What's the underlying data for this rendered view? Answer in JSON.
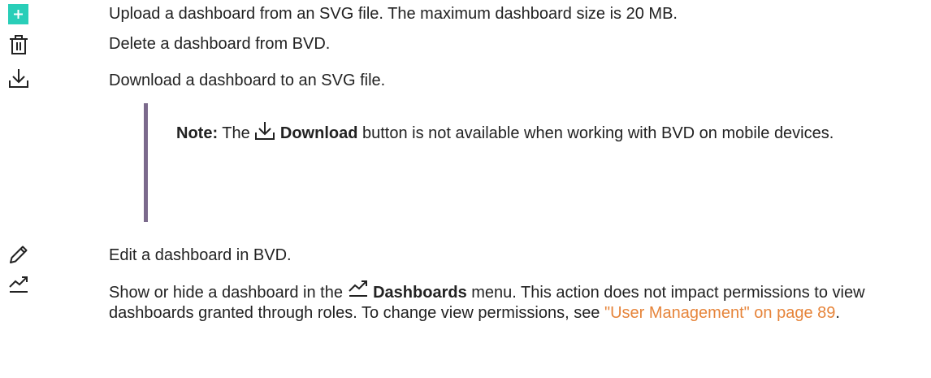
{
  "rows": [
    {
      "icon": "plus-icon",
      "text": "Upload a dashboard from an SVG file. The maximum dashboard size is 20 MB."
    },
    {
      "icon": "trash-icon",
      "text": "Delete a dashboard from BVD."
    },
    {
      "icon": "download-icon",
      "text": "Download a dashboard to an SVG file."
    },
    {
      "icon": "pencil-icon",
      "text": "Edit a dashboard in BVD."
    },
    {
      "icon": "trend-chart-icon",
      "text_before": "Show or hide a dashboard in the ",
      "menu_label": "Dashboards",
      "text_after": " menu. This action does not impact permissions to view dashboards granted through roles. To change view permissions, see ",
      "link": "\"User Management\" on page 89",
      "end": "."
    }
  ],
  "note": {
    "label": "Note:",
    "text_before": " The ",
    "button_label": "Download",
    "text_after": " button is not available when working with BVD on mobile devices."
  },
  "colors": {
    "plus_bg": "#29ceb8",
    "note_border": "#7b6a8c",
    "link": "#e6843a"
  }
}
